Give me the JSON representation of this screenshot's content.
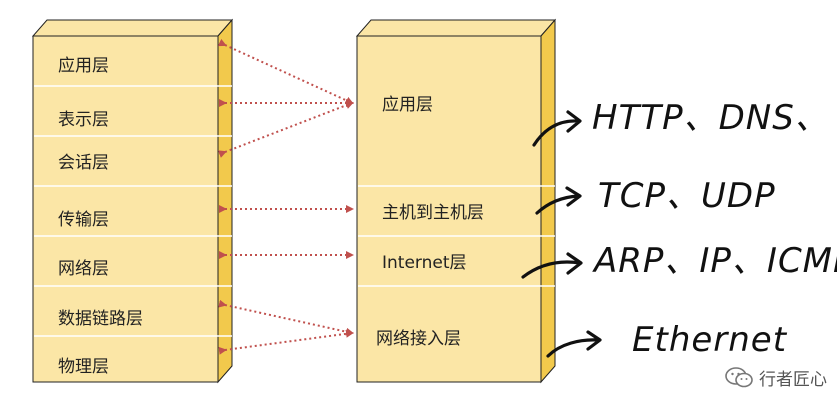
{
  "osi_layers": [
    "应用层",
    "表示层",
    "会话层",
    "传输层",
    "网络层",
    "数据链路层",
    "物理层"
  ],
  "tcpip_layers": [
    "应用层",
    "主机到主机层",
    "Internet层",
    "网络接入层"
  ],
  "protocol_notes": [
    "HTTP、DNS、",
    "TCP、UDP",
    "ARP、IP、ICMP",
    "Ethernet"
  ],
  "watermark": {
    "text": "行者匠心",
    "icon": "wechat-icon"
  },
  "colors": {
    "box_fill": "#fbe6a6",
    "box_side": "#f2c94c",
    "box_stroke": "#222222",
    "arrow": "#c0504d"
  }
}
